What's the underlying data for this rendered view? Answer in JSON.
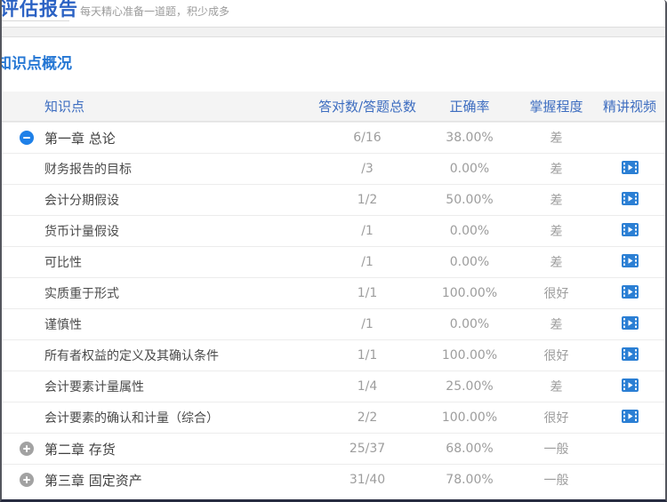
{
  "page": {
    "title": "评估报告",
    "subtitle": "每天精心准备一道题，积少成多",
    "section_heading": "知识点概况"
  },
  "colors": {
    "title_blue": "#2b62c4",
    "section_heading_blue": "#2577d4",
    "table_header_blue": "#3d6dc0",
    "expand_minus_blue": "#1e80e8",
    "collapse_plus_gray": "#a2a2a2",
    "video_icon_blue": "#2b7fd4",
    "muted_value_gray": "#9d9d9d",
    "header_row_bg": "#f4f4f4"
  },
  "icons": {
    "expanded": "minus-circle-icon",
    "collapsed": "plus-circle-icon",
    "video": "filmstrip-play-icon"
  },
  "table": {
    "columns": [
      "知识点",
      "答对数/答题总数",
      "正确率",
      "掌握程度",
      "精讲视频"
    ],
    "rows": [
      {
        "type": "chapter",
        "expanded": true,
        "name": "第一章 总论",
        "score": "6/16",
        "rate": "38.00%",
        "mastery": "差",
        "video": false
      },
      {
        "type": "sub",
        "name": "财务报告的目标",
        "score": "/3",
        "rate": "0.00%",
        "mastery": "差",
        "video": true
      },
      {
        "type": "sub",
        "name": "会计分期假设",
        "score": "1/2",
        "rate": "50.00%",
        "mastery": "差",
        "video": true
      },
      {
        "type": "sub",
        "name": "货币计量假设",
        "score": "/1",
        "rate": "0.00%",
        "mastery": "差",
        "video": true
      },
      {
        "type": "sub",
        "name": "可比性",
        "score": "/1",
        "rate": "0.00%",
        "mastery": "差",
        "video": true
      },
      {
        "type": "sub",
        "name": "实质重于形式",
        "score": "1/1",
        "rate": "100.00%",
        "mastery": "很好",
        "video": true
      },
      {
        "type": "sub",
        "name": "谨慎性",
        "score": "/1",
        "rate": "0.00%",
        "mastery": "差",
        "video": true
      },
      {
        "type": "sub",
        "name": "所有者权益的定义及其确认条件",
        "score": "1/1",
        "rate": "100.00%",
        "mastery": "很好",
        "video": true
      },
      {
        "type": "sub",
        "name": "会计要素计量属性",
        "score": "1/4",
        "rate": "25.00%",
        "mastery": "差",
        "video": true
      },
      {
        "type": "sub",
        "name": "会计要素的确认和计量（综合）",
        "score": "2/2",
        "rate": "100.00%",
        "mastery": "很好",
        "video": true
      },
      {
        "type": "chapter",
        "expanded": false,
        "name": "第二章 存货",
        "score": "25/37",
        "rate": "68.00%",
        "mastery": "一般",
        "video": false
      },
      {
        "type": "chapter",
        "expanded": false,
        "name": "第三章 固定资产",
        "score": "31/40",
        "rate": "78.00%",
        "mastery": "一般",
        "video": false
      }
    ]
  }
}
